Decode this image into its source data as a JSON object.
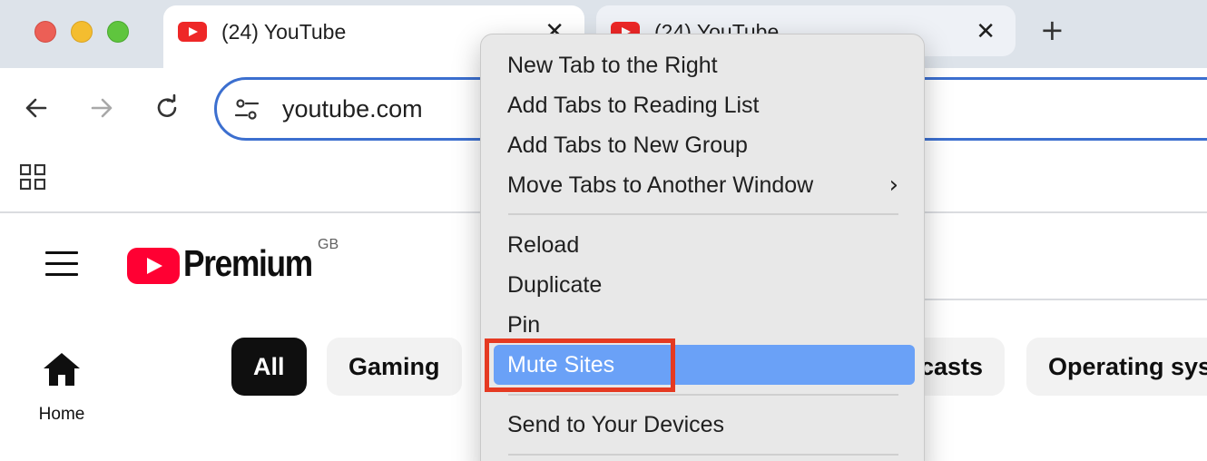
{
  "tabs": [
    {
      "title": "(24) YouTube",
      "close": "✕"
    },
    {
      "title": "(24) YouTube",
      "close": "✕"
    }
  ],
  "new_tab_label": "+",
  "omnibox": {
    "url": "youtube.com"
  },
  "page": {
    "logo_text": "Premium",
    "region": "GB",
    "home_label": "Home",
    "chips": [
      "All",
      "Gaming",
      "casts",
      "Operating syst"
    ]
  },
  "context_menu": {
    "items": [
      {
        "label": "New Tab to the Right"
      },
      {
        "label": "Add Tabs to Reading List"
      },
      {
        "label": "Add Tabs to New Group"
      },
      {
        "label": "Move Tabs to Another Window",
        "submenu_arrow": "›"
      },
      {
        "label": "Reload"
      },
      {
        "label": "Duplicate"
      },
      {
        "label": "Pin"
      },
      {
        "label": "Mute Sites",
        "highlighted": true
      },
      {
        "label": "Send to Your Devices"
      }
    ]
  },
  "colors": {
    "highlight": "#6aa1f7",
    "annotation_box": "#e53a22",
    "youtube_red": "#ff0033",
    "omnibox_border": "#3c6fcf"
  }
}
